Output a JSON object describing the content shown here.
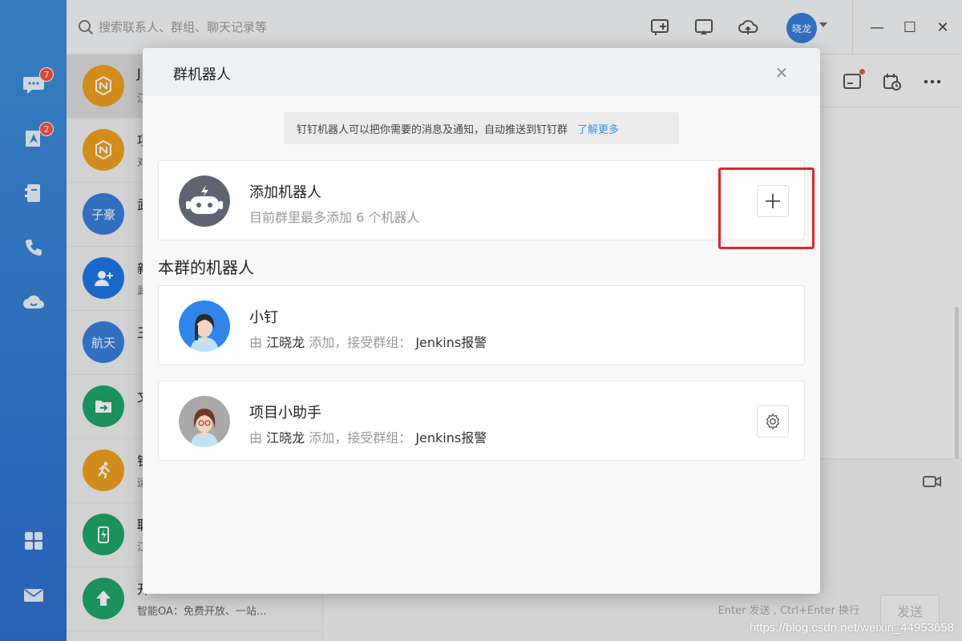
{
  "rail": {
    "badges": {
      "messages": "7",
      "ding": "2"
    }
  },
  "topbar": {
    "search_placeholder": "搜索联系人、群组、聊天记录等",
    "user_avatar_text": "晓龙",
    "minimize": "—",
    "maximize": "☐",
    "close": "✕"
  },
  "conversations": [
    {
      "title": "J",
      "sub": "江",
      "avatar_text": "",
      "color": "#f0a020",
      "selected": true
    },
    {
      "title": "项",
      "sub": "对",
      "avatar_text": "",
      "color": "#f0a020"
    },
    {
      "title": "武",
      "sub": "",
      "avatar_text": "子豪",
      "color": "#3a7fdc"
    },
    {
      "title": "新",
      "sub": "武",
      "avatar_text": "",
      "color": "#1e78e6"
    },
    {
      "title": "王",
      "sub": "",
      "avatar_text": "航天",
      "color": "#3a7fdc"
    },
    {
      "title": "文",
      "sub": "",
      "avatar_text": "",
      "color": "#1fa66a"
    },
    {
      "title": "钉",
      "sub": "运",
      "avatar_text": "",
      "color": "#f0a020"
    },
    {
      "title": "职",
      "sub": "江",
      "avatar_text": "",
      "color": "#1fa66a"
    },
    {
      "title": "开",
      "sub": "智能OA：免费开放、一站...",
      "avatar_text": "",
      "color": "#1fa66a"
    }
  ],
  "chat": {
    "hint": "Enter 发送 , Ctrl+Enter 换行",
    "send_label": "发送",
    "watermark": "https://blog.csdn.net/weixin_44953658"
  },
  "modal": {
    "title": "群机器人",
    "close": "×",
    "tip": "钉钉机器人可以把你需要的消息及通知，自动推送到钉钉群",
    "tip_link": "了解更多",
    "add": {
      "title": "添加机器人",
      "sub": "目前群里最多添加 6 个机器人",
      "button": "+"
    },
    "section_title": "本群的机器人",
    "robots": [
      {
        "name": "小钉",
        "by": "由",
        "adder": "江晓龙",
        "mid": "添加，接受群组：",
        "group": "Jenkins报警"
      },
      {
        "name": "项目小助手",
        "by": "由",
        "adder": "江晓龙",
        "mid": "添加，接受群组：",
        "group": "Jenkins报警"
      }
    ]
  }
}
